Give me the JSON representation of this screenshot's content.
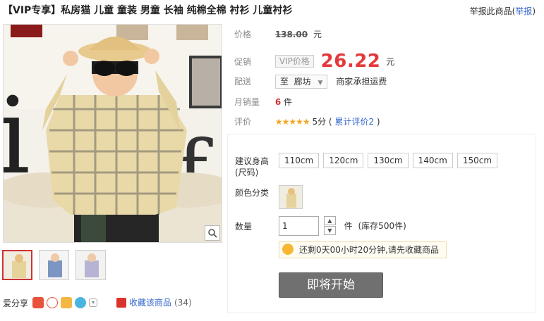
{
  "header": {
    "title": "【VIP专享】私房猫 儿童 童装 男童 长袖 纯棉全棉 衬衫 儿童衬衫",
    "report_prefix": "举报此商品(",
    "report_link": "举报",
    "report_suffix": ")"
  },
  "gallery": {
    "zoom_icon": "magnifier-icon",
    "thumb_count": 3
  },
  "share": {
    "label": "爱分享",
    "icons": [
      "qzone-icon",
      "weibo-icon",
      "star-icon",
      "tencent-weibo-icon",
      "more-dropdown-icon"
    ]
  },
  "favorite": {
    "label": "收藏该商品",
    "count": "(34)"
  },
  "price": {
    "label": "价格",
    "original": "138.00",
    "unit": "元"
  },
  "promo": {
    "label": "促销",
    "tag": "VIP价格",
    "value": "26.22",
    "unit": "元"
  },
  "shipping": {
    "label": "配送",
    "to": "至",
    "city": "廊坊",
    "note": "商家承担运费"
  },
  "sales": {
    "label": "月销量",
    "count": "6",
    "unit": "件"
  },
  "rating": {
    "label": "评价",
    "stars": "★★★★★",
    "score": "5分",
    "reviews_open": "(",
    "reviews_link": "累计评价2",
    "reviews_close": ")"
  },
  "sku": {
    "size_label": "建议身高",
    "size_label_2": "(尺码)",
    "sizes": [
      "110cm",
      "120cm",
      "130cm",
      "140cm",
      "150cm"
    ],
    "color_label": "颜色分类",
    "qty_label": "数量",
    "qty_value": "1",
    "stock_unit": "件",
    "stock": "(库存500件)",
    "tip": "还剩0天00小时20分钟,请先收藏商品",
    "start_button": "即将开始"
  },
  "colors": {
    "accent_price": "#e4393c",
    "link": "#3366cc",
    "button": "#707070"
  }
}
